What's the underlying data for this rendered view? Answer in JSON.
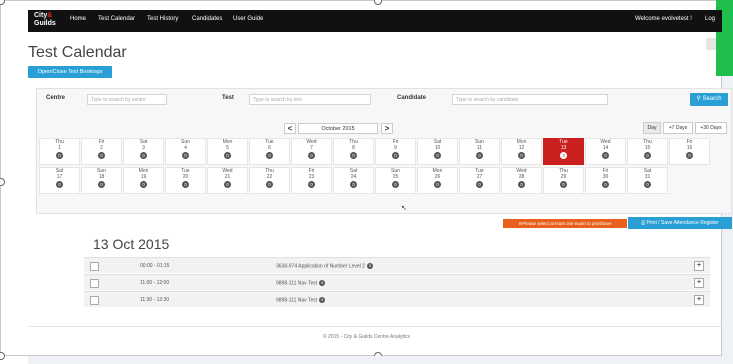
{
  "nav": {
    "logo_line1": "City",
    "logo_x": "&",
    "logo_line2": "Guilds",
    "items": [
      "Home",
      "Test Calendar",
      "Test History",
      "Candidates",
      "User Guide"
    ],
    "welcome": "Welcome evolvetest !",
    "logout": "Log"
  },
  "page": {
    "title": "Test Calendar",
    "open_close_label": "Open/Close Test Bookings"
  },
  "filters": {
    "centre_label": "Centre",
    "centre_placeholder": "Type to search by centre",
    "test_label": "Test",
    "test_placeholder": "Type to search by test",
    "candidate_label": "Candidate",
    "candidate_placeholder": "Type to search by candidate",
    "search_label": "Search"
  },
  "calendar": {
    "month": "October 2015",
    "prev": "<",
    "next": ">",
    "ranges": [
      "Day",
      "+7 Days",
      "+30 Days"
    ],
    "active_range": "Day",
    "days": [
      {
        "dn": "Thu",
        "dd": "1",
        "count": "0"
      },
      {
        "dn": "Fri",
        "dd": "2",
        "count": "0"
      },
      {
        "dn": "Sat",
        "dd": "3",
        "count": "0"
      },
      {
        "dn": "Sun",
        "dd": "4",
        "count": "0"
      },
      {
        "dn": "Mon",
        "dd": "5",
        "count": "0"
      },
      {
        "dn": "Tue",
        "dd": "6",
        "count": "0"
      },
      {
        "dn": "Wed",
        "dd": "7",
        "count": "0"
      },
      {
        "dn": "Thu",
        "dd": "8",
        "count": "0"
      },
      {
        "dn": "Fri",
        "dd": "9",
        "count": "0"
      },
      {
        "dn": "Sat",
        "dd": "10",
        "count": "0"
      },
      {
        "dn": "Sun",
        "dd": "11",
        "count": "0"
      },
      {
        "dn": "Mon",
        "dd": "12",
        "count": "0"
      },
      {
        "dn": "Tue",
        "dd": "13",
        "count": "3",
        "selected": true
      },
      {
        "dn": "Wed",
        "dd": "14",
        "count": "0"
      },
      {
        "dn": "Thu",
        "dd": "15",
        "count": "0"
      },
      {
        "dn": "Fri",
        "dd": "16",
        "count": "0"
      },
      {
        "dn": "Sat",
        "dd": "17",
        "count": "0"
      },
      {
        "dn": "Sun",
        "dd": "18",
        "count": "0"
      },
      {
        "dn": "Mon",
        "dd": "19",
        "count": "0"
      },
      {
        "dn": "Tue",
        "dd": "20",
        "count": "0"
      },
      {
        "dn": "Wed",
        "dd": "21",
        "count": "0"
      },
      {
        "dn": "Thu",
        "dd": "22",
        "count": "0"
      },
      {
        "dn": "Fri",
        "dd": "23",
        "count": "0"
      },
      {
        "dn": "Sat",
        "dd": "24",
        "count": "0"
      },
      {
        "dn": "Sun",
        "dd": "25",
        "count": "0"
      },
      {
        "dn": "Mon",
        "dd": "26",
        "count": "0"
      },
      {
        "dn": "Tue",
        "dd": "27",
        "count": "0"
      },
      {
        "dn": "Wed",
        "dd": "28",
        "count": "0"
      },
      {
        "dn": "Thu",
        "dd": "29",
        "count": "0"
      },
      {
        "dn": "Fri",
        "dd": "30",
        "count": "0"
      },
      {
        "dn": "Sat",
        "dd": "31",
        "count": "0"
      }
    ]
  },
  "actions": {
    "warning": "⊖Please select at least one exam to print/save",
    "print_label": "⎙ Print / Save Attendance Register"
  },
  "sessions": {
    "date_heading": "13 Oct 2015",
    "rows": [
      {
        "time": "00:00 - 01:15",
        "name": "3638-974 Application of Number Level 2"
      },
      {
        "time": "11:00 - 12:00",
        "name": "9898-111 Nav Test"
      },
      {
        "time": "11:30 - 12:30",
        "name": "9898-111 Nav Test"
      }
    ]
  },
  "footer": {
    "text": "© 2015 - City & Guilds Centre Analytics"
  },
  "colors": {
    "accent": "#2a9fd6",
    "selected": "#cc1f1f",
    "warning": "#e8601c",
    "nav_bg": "#111111"
  }
}
